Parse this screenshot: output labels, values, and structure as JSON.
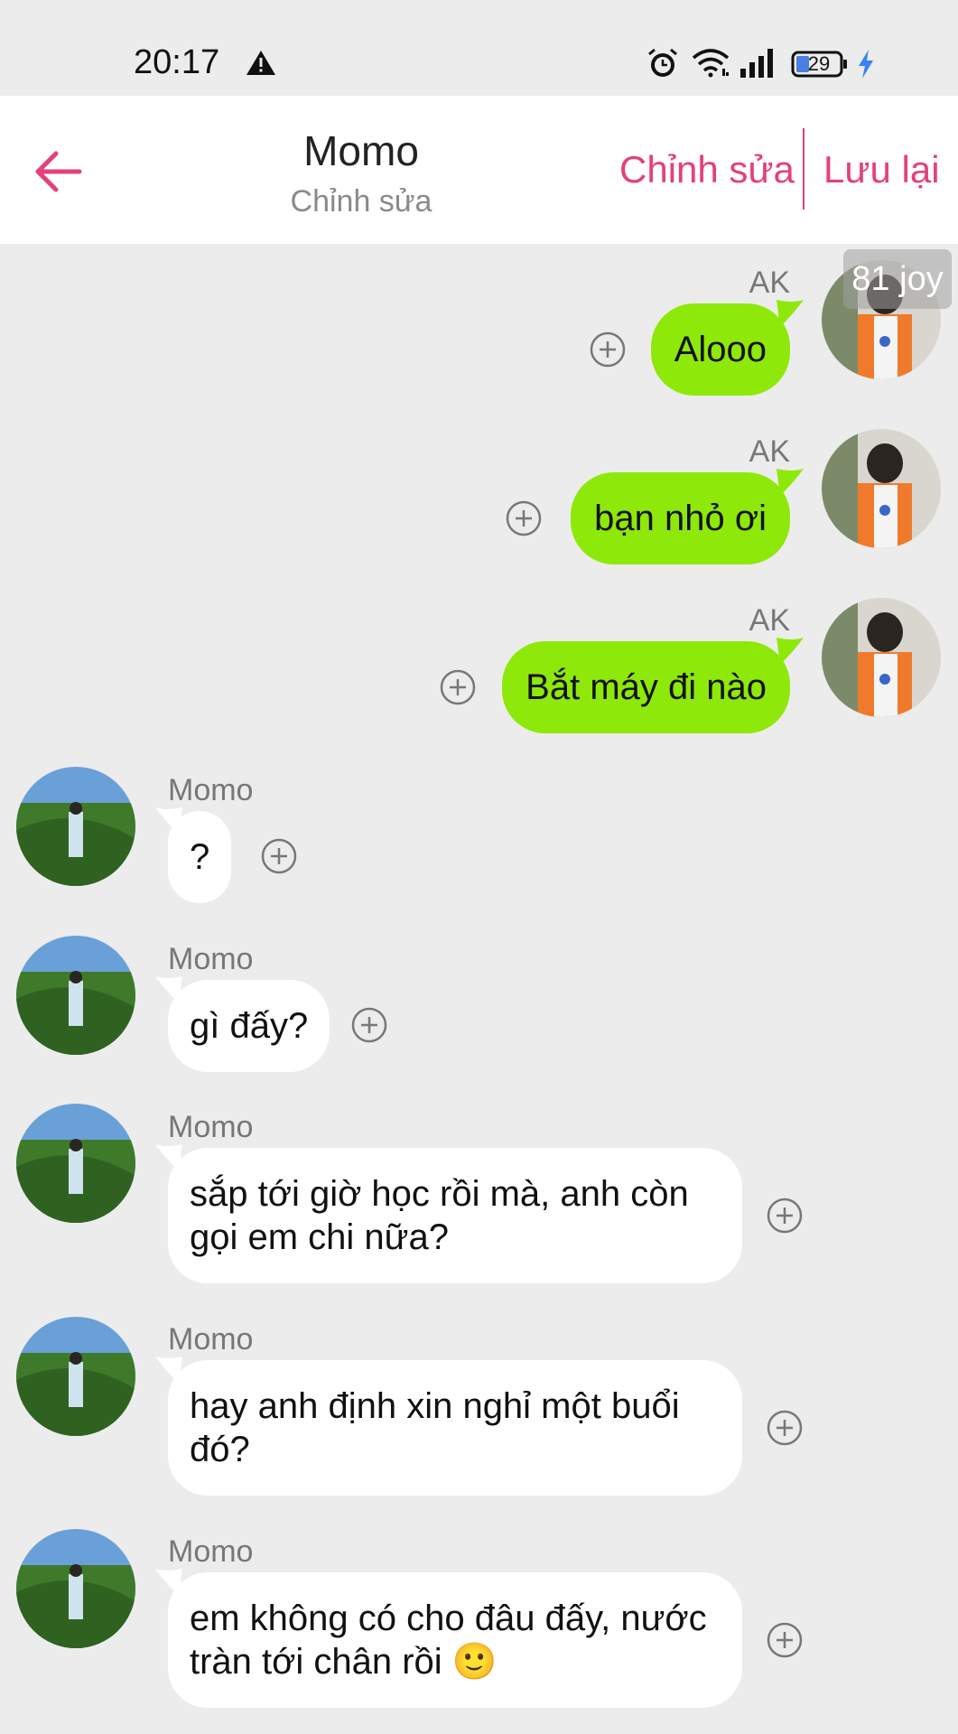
{
  "status_bar": {
    "time": "20:17",
    "battery": "29",
    "icons": [
      "warning-icon",
      "alarm-icon",
      "wifi-icon",
      "signal-icon",
      "battery-icon",
      "charging-icon"
    ]
  },
  "header": {
    "title": "Momo",
    "subtitle": "Chỉnh sửa",
    "edit_label": "Chỉnh sửa",
    "save_label": "Lưu lại",
    "accent": "#e5407c"
  },
  "overlay_badge": "81 joy",
  "messages": [
    {
      "sender": "AK",
      "side": "right",
      "text": "Alooo"
    },
    {
      "sender": "AK",
      "side": "right",
      "text": "bạn nhỏ ơi"
    },
    {
      "sender": "AK",
      "side": "right",
      "text": "Bắt máy đi nào"
    },
    {
      "sender": "Momo",
      "side": "left",
      "text": "?"
    },
    {
      "sender": "Momo",
      "side": "left",
      "text": "gì đấy?"
    },
    {
      "sender": "Momo",
      "side": "left",
      "text": "sắp tới giờ học rồi mà, anh còn gọi em chi nữa?"
    },
    {
      "sender": "Momo",
      "side": "left",
      "text": "hay anh định xin nghỉ một buổi đó?"
    },
    {
      "sender": "Momo",
      "side": "left",
      "text": "em không có cho đâu đấy, nước tràn tới chân rồi 🙂"
    }
  ],
  "colors": {
    "my_bubble": "#8ee80a",
    "their_bubble": "#ffffff",
    "background": "#ececec"
  }
}
